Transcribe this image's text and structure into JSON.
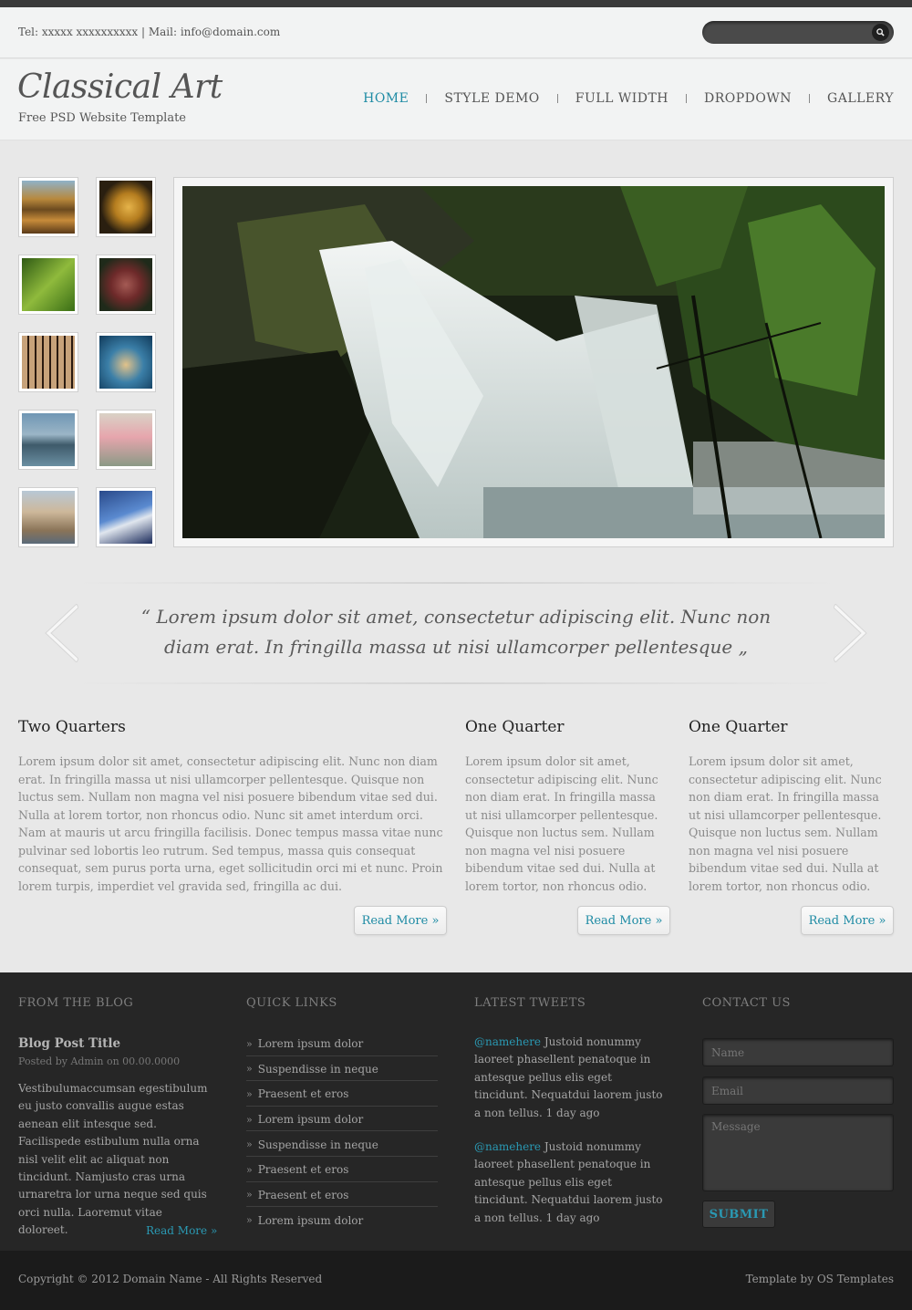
{
  "topbar": {
    "contact": "Tel: xxxxx xxxxxxxxxx | Mail: info@domain.com",
    "search_placeholder": "",
    "search_icon": "search-icon"
  },
  "header": {
    "title": "Classical Art",
    "subtitle": "Free PSD Website Template"
  },
  "nav": {
    "items": [
      {
        "label": "HOME",
        "active": true
      },
      {
        "label": "STYLE DEMO"
      },
      {
        "label": "FULL WIDTH"
      },
      {
        "label": "DROPDOWN"
      },
      {
        "label": "GALLERY"
      }
    ]
  },
  "quote": {
    "text": "“ Lorem ipsum dolor sit amet, consectetur adipiscing elit. Nunc non diam erat. In fringilla massa ut nisi ullamcorper pellentesque „"
  },
  "columns": [
    {
      "title": "Two Quarters",
      "text": "Lorem ipsum dolor sit amet, consectetur adipiscing elit. Nunc non diam erat. In fringilla massa ut nisi ullamcorper pellentesque. Quisque non luctus sem. Nullam non magna vel nisi posuere bibendum vitae sed dui. Nulla at lorem tortor, non rhoncus odio. Nunc sit amet interdum orci. Nam at mauris ut arcu fringilla facilisis. Donec tempus massa vitae nunc pulvinar sed lobortis leo rutrum. Sed tempus, massa quis consequat consequat, sem purus porta urna, eget sollicitudin orci mi et nunc. Proin lorem turpis, imperdiet vel gravida sed, fringilla ac dui.",
      "button": "Read More »"
    },
    {
      "title": "One Quarter",
      "text": "Lorem ipsum dolor sit amet, consectetur adipiscing elit. Nunc non diam erat. In fringilla massa ut nisi ullamcorper pellentesque. Quisque non luctus sem. Nullam non magna vel nisi posuere bibendum vitae sed dui. Nulla at lorem tortor, non rhoncus odio.",
      "button": "Read More »"
    },
    {
      "title": "One Quarter",
      "text": "Lorem ipsum dolor sit amet, consectetur adipiscing elit. Nunc non diam erat. In fringilla massa ut nisi ullamcorper pellentesque. Quisque non luctus sem. Nullam non magna vel nisi posuere bibendum vitae sed dui. Nulla at lorem tortor, non rhoncus odio.",
      "button": "Read More »"
    }
  ],
  "footer": {
    "blog": {
      "heading": "FROM THE BLOG",
      "post_title": "Blog Post Title",
      "meta": "Posted by Admin on 00.00.0000",
      "text": "Vestibulumaccumsan egestibulum eu justo convallis augue estas aenean elit intesque sed. Facilispede estibulum nulla orna nisl velit elit ac aliquat non tincidunt. Namjusto cras urna urnaretra lor urna neque sed quis orci nulla. Laoremut vitae doloreet.",
      "more": "Read More »"
    },
    "links": {
      "heading": "QUICK LINKS",
      "items": [
        "Lorem ipsum dolor",
        "Suspendisse in neque",
        "Praesent et eros",
        "Lorem ipsum dolor",
        "Suspendisse in neque",
        "Praesent et eros",
        "Praesent et eros",
        "Lorem ipsum dolor"
      ]
    },
    "tweets": {
      "heading": "LATEST TWEETS",
      "items": [
        {
          "handle": "@namehere",
          "text": " Justoid nonummy laoreet phasellent penatoque in antesque pellus elis eget tincidunt. Nequatdui laorem justo a non tellus. 1 day ago"
        },
        {
          "handle": "@namehere",
          "text": " Justoid nonummy laoreet phasellent penatoque in antesque pellus elis eget tincidunt. Nequatdui laorem justo a non tellus. 1 day ago"
        }
      ]
    },
    "contact": {
      "heading": "CONTACT US",
      "name_placeholder": "Name",
      "email_placeholder": "Email",
      "message_placeholder": "Message",
      "submit": "SUBMIT"
    },
    "copyright": "Copyright © 2012 Domain Name - All Rights Reserved",
    "credit": "Template by OS Templates"
  },
  "colors": {
    "accent": "#1e8ba4",
    "footer_bg": "#262626",
    "page_bg": "#e8e8e8"
  }
}
